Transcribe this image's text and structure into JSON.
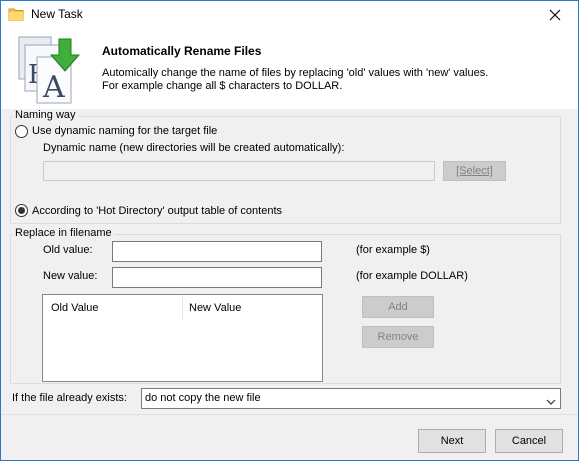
{
  "window": {
    "title": "New Task"
  },
  "header": {
    "title": "Automatically Rename Files",
    "desc_line1": "Automically change the name of files by replacing  'old'  values with  'new' values.",
    "desc_line2": "For example change all $ characters to DOLLAR."
  },
  "naming": {
    "group_label": "Naming way",
    "option_dynamic": "Use dynamic naming for the target file",
    "dynamic_name_label": "Dynamic name (new directories will be created automatically):",
    "dynamic_name_value": "",
    "select_label": "[Select]",
    "option_hot_dir": "According to 'Hot Directory' output table of contents",
    "selected": "hot_dir"
  },
  "replace": {
    "group_label": "Replace in filename",
    "old_label": "Old value:",
    "old_value": "",
    "old_example": "(for example $)",
    "new_label": "New value:",
    "new_value": "",
    "new_example": "(for example DOLLAR)",
    "columns": [
      "Old Value",
      "New Value"
    ],
    "add_label": "Add",
    "remove_label": "Remove"
  },
  "exists": {
    "label": "If the file already exists:",
    "value": "do not copy the new file"
  },
  "footer": {
    "next_label": "Next",
    "cancel_label": "Cancel"
  }
}
